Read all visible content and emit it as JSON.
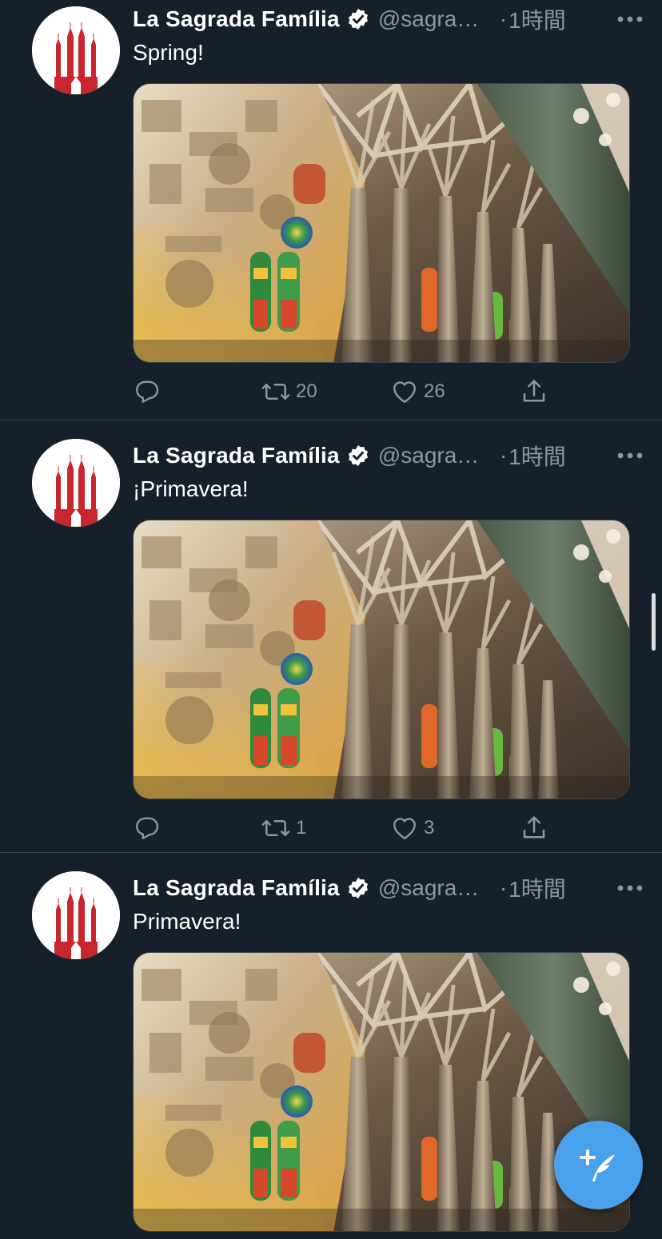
{
  "colors": {
    "background": "#15202b",
    "divider": "#38444d",
    "secondary_text": "#8899a6",
    "accent": "#4aa1eb",
    "avatar_red": "#c8262c"
  },
  "tweets": [
    {
      "name": "La Sagrada Família",
      "handle": "@sagrada_familia",
      "dot": "·",
      "time": "1時間",
      "text": "Spring!",
      "media_icon": "basilica-interior-photo",
      "retweets": "20",
      "likes": "26"
    },
    {
      "name": "La Sagrada Família",
      "handle": "@sagrada_familia",
      "dot": "·",
      "time": "1時間",
      "text": "¡Primavera!",
      "media_icon": "basilica-interior-photo",
      "retweets": "1",
      "likes": "3"
    },
    {
      "name": "La Sagrada Família",
      "handle": "@sagrada_familia",
      "dot": "·",
      "time": "1時間",
      "text": "Primavera!",
      "media_icon": "basilica-interior-photo"
    }
  ],
  "icons": {
    "verified": "verified-badge-icon",
    "more": "more-dots-icon",
    "reply": "reply-icon",
    "retweet": "retweet-icon",
    "like": "heart-icon",
    "share": "share-icon",
    "compose": "compose-tweet-icon"
  }
}
